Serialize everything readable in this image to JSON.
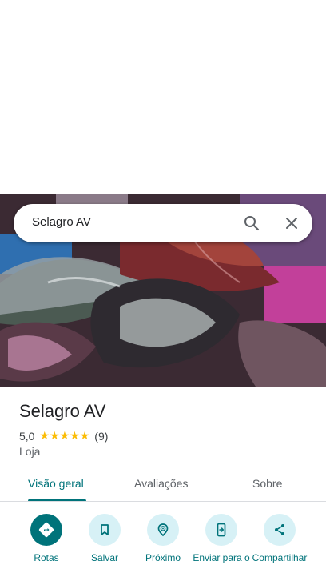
{
  "search": {
    "query": "Selagro AV"
  },
  "place": {
    "name": "Selagro AV",
    "rating": "5,0",
    "stars": [
      "★",
      "★",
      "★",
      "★",
      "★"
    ],
    "review_count": "(9)",
    "category": "Loja"
  },
  "tabs": [
    {
      "label": "Visão geral",
      "active": true
    },
    {
      "label": "Avaliações",
      "active": false
    },
    {
      "label": "Sobre",
      "active": false
    }
  ],
  "actions": [
    {
      "label": "Rotas",
      "icon": "directions-icon"
    },
    {
      "label": "Salvar",
      "icon": "bookmark-icon"
    },
    {
      "label": "Próximo",
      "icon": "nearby-icon"
    },
    {
      "label": "Enviar para o",
      "icon": "send-to-phone-icon"
    },
    {
      "label": "Compartilhar",
      "icon": "share-icon"
    }
  ],
  "colors": {
    "accent": "#00737a",
    "action_bg": "#d7f1f6",
    "star": "#fbbc04"
  }
}
